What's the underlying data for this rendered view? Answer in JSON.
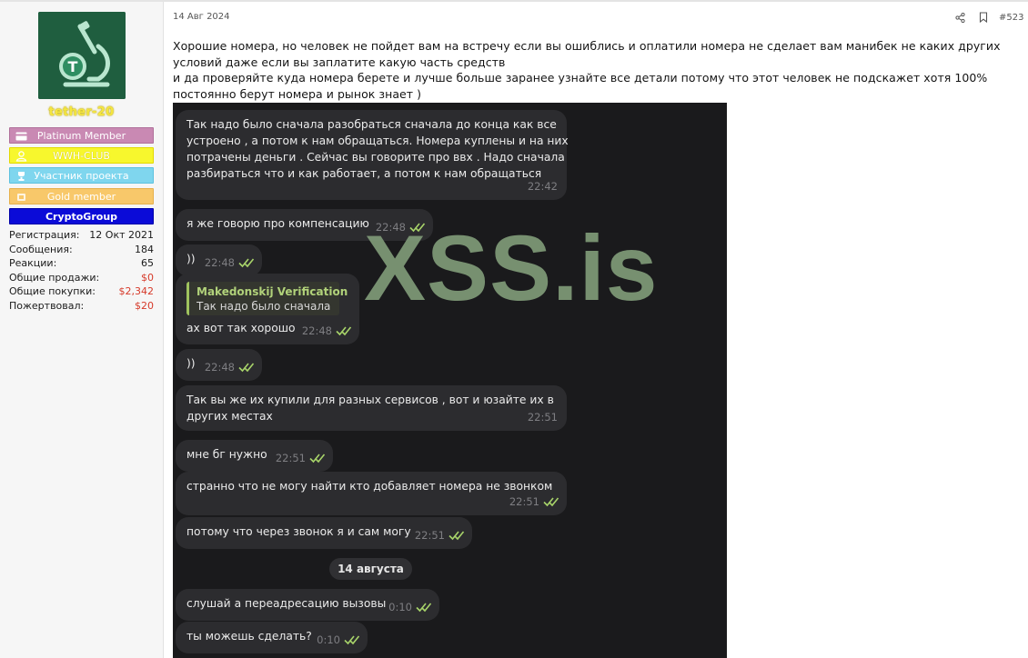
{
  "sidebar": {
    "username": "tether-20",
    "banners": [
      {
        "label": "Platinum Member",
        "icon": "card-icon"
      },
      {
        "label": "WWH-CLUB",
        "icon": "user-icon"
      },
      {
        "label": "Участник проекта",
        "icon": "trophy-icon"
      },
      {
        "label": "Gold member",
        "icon": "coins-icon"
      },
      {
        "label": "CryptoGroup",
        "icon": ""
      }
    ],
    "stats": [
      {
        "label": "Регистрация:",
        "value": "12 Окт 2021"
      },
      {
        "label": "Сообщения:",
        "value": "184"
      },
      {
        "label": "Реакции:",
        "value": "65"
      },
      {
        "label": "Общие продажи:",
        "value": "$0"
      },
      {
        "label": "Общие покупки:",
        "value": "$2,342"
      },
      {
        "label": "Пожертвовал:",
        "value": "$20"
      }
    ]
  },
  "post": {
    "date": "14 Авг 2024",
    "number": "#523",
    "lines": [
      "Хорошие номера, но человек не пойдет вам на встречу если вы ошиблись и оплатили номера не сделает вам манибек не каких других",
      "условий даже если вы заплатите какую часть средств",
      "и да проверяйте куда номера берете и лучше больше заранее узнайте все детали потому что этот человек не подскажет хотя 100%",
      "постоянно берут номера и рынок знает )"
    ]
  },
  "chat": {
    "watermark": "XSS.is",
    "messages": [
      {
        "lines": [
          "Так надо было сначала разобраться сначала до конца как все",
          "устроено , а потом к нам обращаться. Номера куплены и на них",
          "потрачены деньги . Сейчас вы говорите про ввх . Надо сначала",
          "разбираться что и как работает, а потом к нам обращаться"
        ],
        "time": "22:42"
      },
      {
        "text": "я же говорю про компенсацию",
        "time": "22:48"
      },
      {
        "text": "))",
        "time": "22:48"
      },
      {
        "reply_name": "Makedonskij Verification",
        "reply_text": "Так надо было сначала р...",
        "text": "ах вот так хорошо",
        "time": "22:48"
      },
      {
        "text": "))",
        "time": "22:48"
      },
      {
        "lines": [
          "Так вы же их купили для разных сервисов , вот и юзайте их в",
          "других местах"
        ],
        "time": "22:51"
      },
      {
        "text": "мне бг нужно",
        "time": "22:51"
      },
      {
        "text": "странно что не могу найти кто добавляет номера не звонком",
        "time": "22:51"
      },
      {
        "text": "потому что через звонок я и сам могу",
        "time": "22:51"
      },
      {
        "text": "слушай а переадресацию вызовы",
        "time": "0:10"
      },
      {
        "text": "ты можешь сделать?",
        "time": "0:10"
      }
    ],
    "date_separator": "14 августа"
  },
  "colors": {
    "crypto_banner": "#0b0bd8",
    "chat_bg": "#1a1a1c",
    "bubble": "#2c2c2f",
    "reply_accent": "#9fc25e",
    "watermark": "#7f9a78",
    "username": "#f5e640"
  }
}
